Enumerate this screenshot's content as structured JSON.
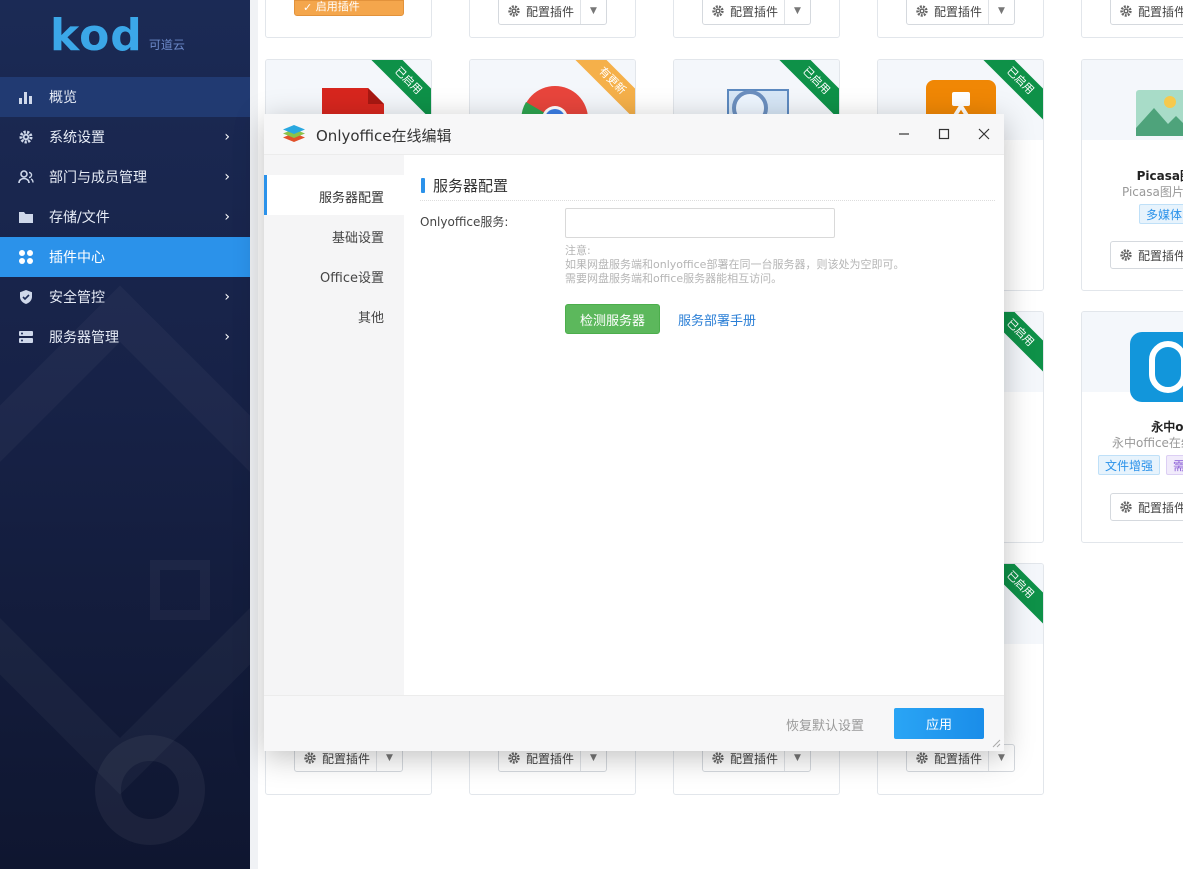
{
  "brand": {
    "logo": "kod",
    "subtitle": "可道云"
  },
  "sidebar": {
    "items": [
      {
        "label": "概览",
        "icon": "bar-chart-icon"
      },
      {
        "label": "系统设置",
        "icon": "gear-icon"
      },
      {
        "label": "部门与成员管理",
        "icon": "users-icon"
      },
      {
        "label": "存储/文件",
        "icon": "folder-icon"
      },
      {
        "label": "插件中心",
        "icon": "grid-icon",
        "active": true
      },
      {
        "label": "安全管控",
        "icon": "shield-icon"
      },
      {
        "label": "服务器管理",
        "icon": "server-icon"
      }
    ]
  },
  "background_cards": {
    "config_label": "配置插件",
    "enable_label": "启用插件",
    "ribbon_enabled": "已启用",
    "ribbon_update": "有更新",
    "picasa": {
      "title": "Picasa图片",
      "sub": "Picasa图片",
      "tag": "多媒体"
    },
    "yozo": {
      "title": "永中offic",
      "sub": "永中office在线",
      "tags": [
        "文件增强",
        "需"
      ]
    }
  },
  "dialog": {
    "title": "Onlyoffice在线编辑",
    "nav": [
      "服务器配置",
      "基础设置",
      "Office设置",
      "其他"
    ],
    "section_title": "服务器配置",
    "field_label": "Onlyoffice服务:",
    "field_value": "",
    "note_title": "注意:",
    "note_line1": "如果网盘服务端和onlyoffice部署在同一台服务器，则该处为空即可。",
    "note_line2": "需要网盘服务端和office服务器能相互访问。",
    "check_button": "检测服务器",
    "manual_link": "服务部署手册",
    "reset_label": "恢复默认设置",
    "apply_label": "应用"
  },
  "colors": {
    "sidebar_bg": "#172247",
    "accent": "#2b92ea",
    "success": "#5cb85c",
    "ribbon": "#0e9148"
  }
}
